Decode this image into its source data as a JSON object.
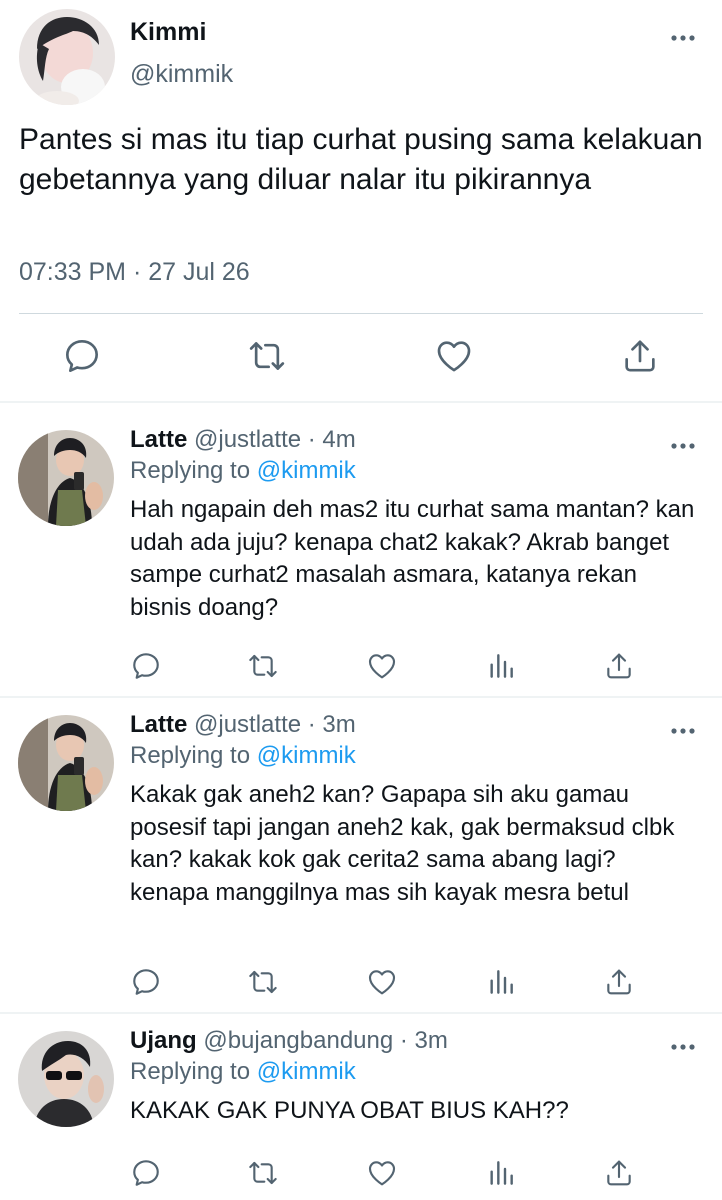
{
  "main_tweet": {
    "name": "Kimmi",
    "handle": "@kimmik",
    "text": "Pantes si mas itu tiap curhat pusing sama kelakuan gebetannya yang diluar nalar itu pikirannya",
    "timestamp": "07:33 PM · 27 Jul 26",
    "actions": [
      "reply-icon",
      "retweet-icon",
      "like-icon",
      "share-icon"
    ]
  },
  "replies": [
    {
      "name": "Latte",
      "handle": "@justlatte · 4m",
      "replying_prefix": "Replying to",
      "replying_to": "@kimmik",
      "text": "Hah ngapain deh mas2 itu curhat sama mantan? kan udah ada juju? kenapa chat2 kakak? Akrab banget sampe curhat2 masalah asmara, katanya rekan bisnis doang?"
    },
    {
      "name": "Latte",
      "handle": "@justlatte · 3m",
      "replying_prefix": "Replying to",
      "replying_to": "@kimmik",
      "text": "Kakak gak aneh2 kan? Gapapa sih aku gamau posesif tapi jangan aneh2 kak, gak bermaksud clbk kan? kakak kok gak cerita2 sama abang lagi? kenapa manggilnya mas sih kayak mesra betul"
    },
    {
      "name": "Ujang",
      "handle": "@bujangbandung · 3m",
      "replying_prefix": "Replying to",
      "replying_to": "@kimmik",
      "text": "KAKAK GAK PUNYA OBAT BIUS KAH??"
    }
  ],
  "reply_actions": [
    "reply-icon",
    "retweet-icon",
    "like-icon",
    "analytics-icon",
    "share-icon"
  ],
  "colors": {
    "text": "#0f1419",
    "secondary": "#536471",
    "link": "#1d9bf0",
    "divider": "#cfd9de"
  }
}
